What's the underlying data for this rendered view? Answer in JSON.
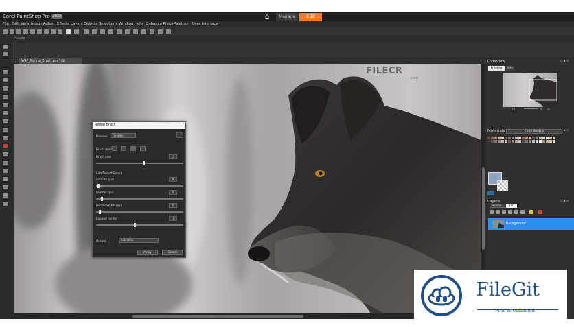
{
  "app": {
    "name": "Corel PaintShop Pro",
    "version": "2023"
  },
  "mode_tabs": {
    "home_icon": "home-icon",
    "manage": "Manage",
    "edit": "Edit",
    "active": "Edit"
  },
  "menu": [
    "File",
    "Edit",
    "View",
    "Image",
    "Adjust",
    "Effects",
    "Layers",
    "Objects",
    "Selections",
    "Window",
    "Help",
    "Enhance Photo",
    "Palettes",
    "User Interface"
  ],
  "presets_label": "Presets",
  "document_tab": "W4F_Refine_Brush.psd* @",
  "refine_brush": {
    "title": "Refine Brush",
    "preview_label": "Preview",
    "preview_value": "Overlay",
    "brush_mode_label": "Brush mode",
    "brush_size_label": "Brush size",
    "brush_size_value": "15",
    "brush_size_level": 0.55,
    "smart_radius_label": "Edit/Detect Smart",
    "smooth_label": "Smooth (px)",
    "smooth_value": "0",
    "smooth_level": 0.02,
    "feather_label": "Feather (px)",
    "feather_value": "0",
    "feather_level": 0.06,
    "border_width_label": "Border Width (px)",
    "border_width_value": "0",
    "border_width_level": 0.03,
    "expand_label": "Expand border",
    "expand_value": "10",
    "expand_level": 0.44,
    "output_label": "Output",
    "output_value": "Selection",
    "apply_label": "Apply",
    "cancel_label": "Cancel"
  },
  "overview": {
    "title": "Overview",
    "preview_tab": "Preview",
    "info_tab": "Info",
    "zoom_value": "25"
  },
  "materials": {
    "title": "Materials",
    "swatch_set": "Corel Neutral"
  },
  "layers": {
    "title": "Layers",
    "blend_mode": "Normal",
    "opacity": "100",
    "layer_name": "Background"
  },
  "watermarks": {
    "filecr": "FILECR",
    "filecr_dot": ".com",
    "filegit_name": "FileGit",
    "filegit_tag": "Free & Unlimited"
  },
  "colors": {
    "accent": "#f07d2b",
    "layer_selected": "#2e8ff2",
    "filegit_blue": "#1f4f82"
  }
}
